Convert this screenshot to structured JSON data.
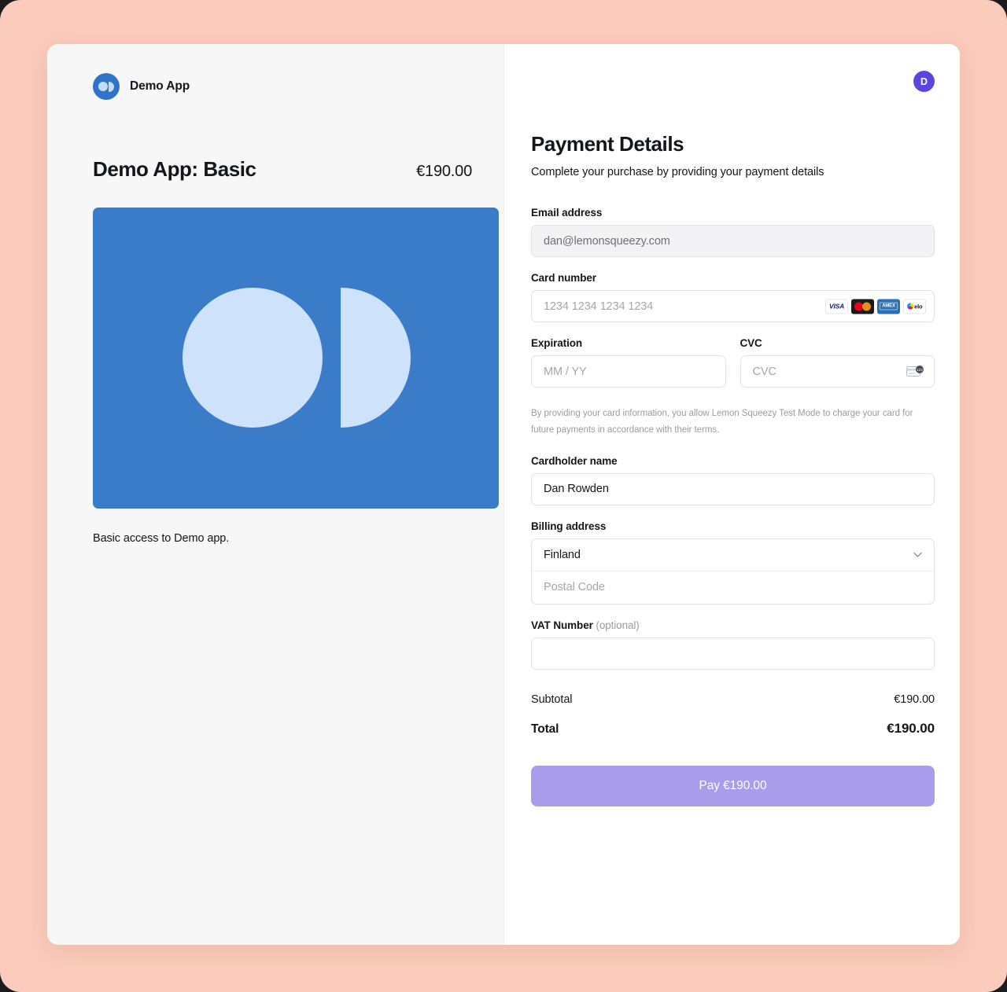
{
  "theme": {
    "page_background": "#fbcbbb",
    "panel_background": "#f7f7f8",
    "accent_purple": "#5b45e0",
    "pay_button_color": "#a89ceb",
    "product_image_blue": "#3b7cc9"
  },
  "left": {
    "brand_name": "Demo App",
    "logo_icon": "demo-app-logo-icon",
    "product_title": "Demo App: Basic",
    "product_price": "€190.00",
    "product_image_icon": "demo-app-product-artwork",
    "product_description": "Basic access to Demo app."
  },
  "right": {
    "avatar_initial": "D",
    "heading": "Payment Details",
    "subheading": "Complete your purchase by providing your payment details",
    "fields": {
      "email": {
        "label": "Email address",
        "value": "dan@lemonsqueezy.com",
        "placeholder": "dan@lemonsqueezy.com"
      },
      "card_number": {
        "label": "Card number",
        "value": "",
        "placeholder": "1234 1234 1234 1234",
        "brands": [
          {
            "name": "visa",
            "label": "VISA"
          },
          {
            "name": "mastercard",
            "label": ""
          },
          {
            "name": "amex",
            "label": "AMEX"
          },
          {
            "name": "elo",
            "label": "elo"
          }
        ]
      },
      "expiration": {
        "label": "Expiration",
        "value": "",
        "placeholder": "MM / YY"
      },
      "cvc": {
        "label": "CVC",
        "value": "",
        "placeholder": "CVC",
        "icon": "credit-card-cvc-icon"
      },
      "cardholder_name": {
        "label": "Cardholder name",
        "value": "Dan Rowden",
        "placeholder": "Cardholder name"
      },
      "billing_address": {
        "label": "Billing address",
        "country_value": "Finland",
        "postal_placeholder": "Postal Code",
        "postal_value": ""
      },
      "vat_number": {
        "label": "VAT Number",
        "optional_suffix": "(optional)",
        "value": "",
        "placeholder": ""
      }
    },
    "disclaimer": "By providing your card information, you allow Lemon Squeezy Test Mode to charge your card for future payments in accordance with their terms.",
    "totals": {
      "subtotal_label": "Subtotal",
      "subtotal_value": "€190.00",
      "total_label": "Total",
      "total_value": "€190.00"
    },
    "pay_button_label": "Pay €190.00"
  }
}
